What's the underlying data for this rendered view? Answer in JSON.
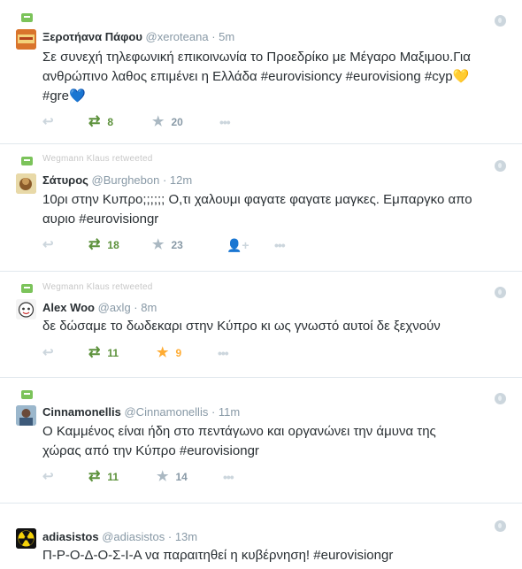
{
  "tweets": [
    {
      "name": "Ξεροτήανα Πάφου",
      "handle": "@xeroteana",
      "time": "5m",
      "text_lines": [
        "Σε συνεχή τηλεφωνική επικοινωνία το Προεδρίκο με Μέγαρο Μαξιμου.Για",
        "ανθρώπινο λαθος επιμένει η Ελλάδα #eurovisioncy #eurovisiong #cyp💛",
        "#gre💙"
      ],
      "context": "",
      "retweets": "8",
      "favorites": "20"
    },
    {
      "name": "Σάτυρος",
      "handle": "@Burghebon",
      "time": "12m",
      "text_lines": [
        "10ρι στην Κυπρο;;;;;; Ο,τι χαλουμι φαγατε φαγατε μαγκες. Εμπαργκο απο",
        "αυριο #eurovisiongr"
      ],
      "context": "Wegmann Klaus retweeted",
      "retweets": "18",
      "favorites": "23"
    },
    {
      "name": "Alex Woo",
      "handle": "@axlg",
      "time": "8m",
      "text_lines": [
        "δε δώσαμε το δωδεκαρι στην Κύπρο κι ως γνωστό αυτοί δε ξεχνούν"
      ],
      "context": "Wegmann Klaus retweeted",
      "retweets": "11",
      "favorites": "9"
    },
    {
      "name": "Cinnamonellis",
      "handle": "@Cinnamonellis",
      "time": "11m",
      "text_lines": [
        "Ο Καμμένος είναι ήδη στο πεντάγωνο και οργανώνει την άμυνα της",
        "χώρας από την Κύπρο #eurovisiongr"
      ],
      "context": "",
      "retweets": "11",
      "favorites": "14"
    },
    {
      "name": "adiasistos",
      "handle": "@adiasistos",
      "time": "13m",
      "text_lines": [
        "Π-Ρ-Ο-Δ-Ο-Σ-Ι-Α να παραιτηθεί η κυβέρνηση! #eurovisiongr"
      ],
      "context": "",
      "retweets": "",
      "favorites": ""
    }
  ],
  "colors": {
    "retweet_green": "#5c913b",
    "favorite_gold": "#ffac33",
    "meta_gray": "#8899a6",
    "text": "#292f33"
  }
}
